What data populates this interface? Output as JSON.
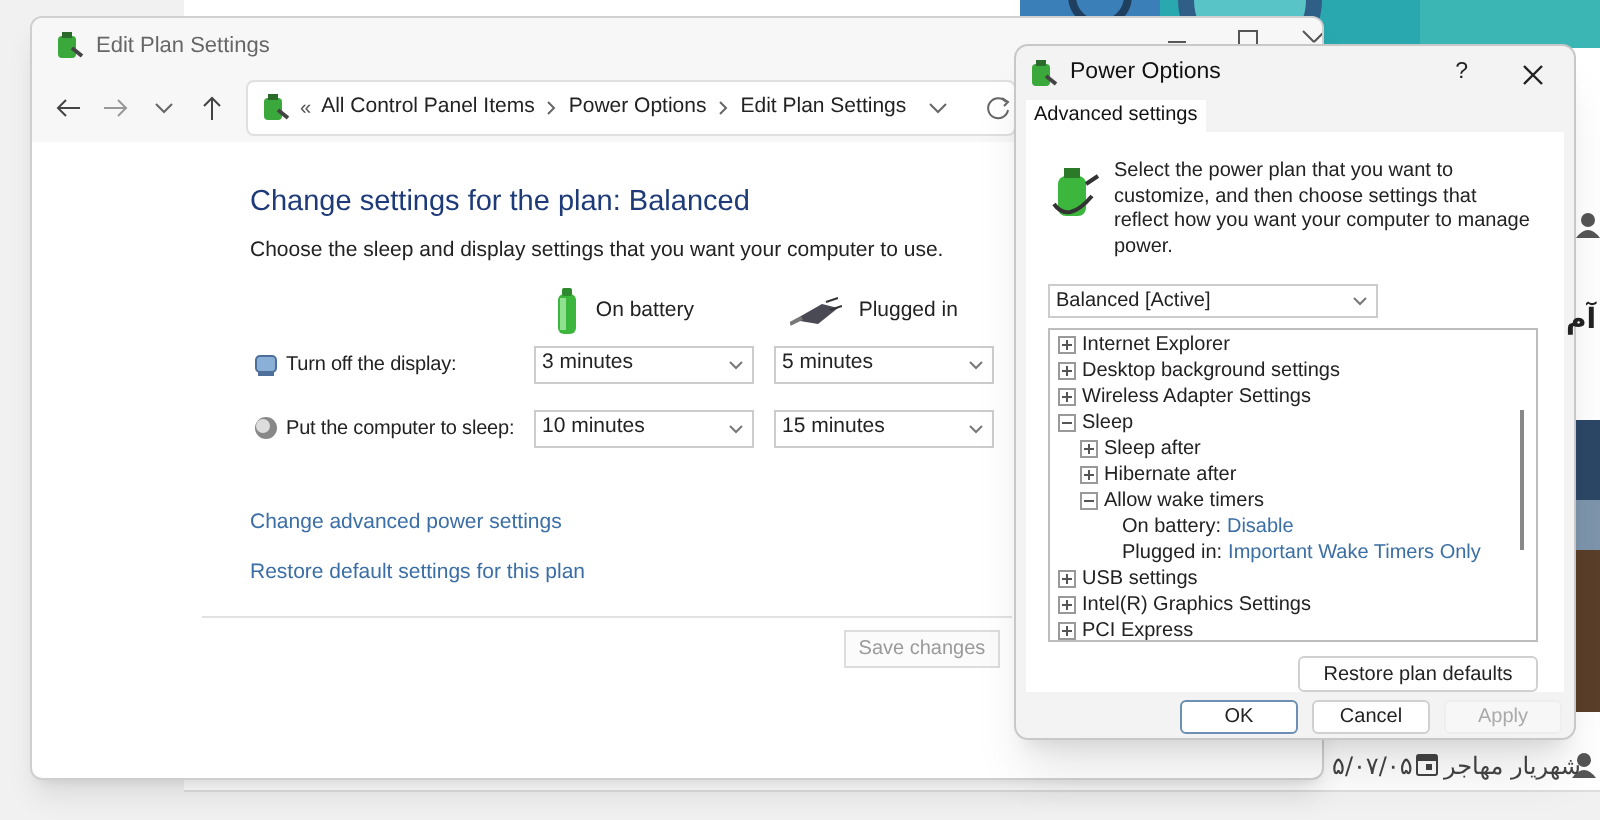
{
  "background_page": {
    "heading_fragment": "آم",
    "author": "شهریار مهاجر",
    "date": "۵/۰۷/۰۵"
  },
  "edit_plan_window": {
    "title": "Edit Plan Settings",
    "breadcrumb_overflow": "«",
    "breadcrumb": [
      "All Control Panel Items",
      "Power Options",
      "Edit Plan Settings"
    ],
    "heading": "Change settings for the plan: Balanced",
    "description": "Choose the sleep and display settings that you want your computer to use.",
    "columns": [
      {
        "kind": "battery",
        "label": "On battery"
      },
      {
        "kind": "plug",
        "label": "Plugged in"
      }
    ],
    "settings": [
      {
        "kind": "display",
        "label": "Turn off the display:",
        "values": [
          "3 minutes",
          "5 minutes"
        ]
      },
      {
        "kind": "sleep",
        "label": "Put the computer to sleep:",
        "values": [
          "10 minutes",
          "15 minutes"
        ]
      }
    ],
    "links": [
      "Change advanced power settings",
      "Restore default settings for this plan"
    ],
    "save_button": {
      "label": "Save changes",
      "disabled": true
    }
  },
  "power_options_dialog": {
    "title": "Power Options",
    "help": "?",
    "tabs": [
      {
        "label": "Advanced settings",
        "selected": true
      }
    ],
    "intro": "Select the power plan that you want to customize, and then choose settings that reflect how you want your computer to manage power.",
    "plan_select": "Balanced [Active]",
    "tree": [
      {
        "label": "Internet Explorer",
        "expanded": false
      },
      {
        "label": "Desktop background settings",
        "expanded": false
      },
      {
        "label": "Wireless Adapter Settings",
        "expanded": false
      },
      {
        "label": "Sleep",
        "expanded": true,
        "children": [
          {
            "label": "Sleep after",
            "expanded": false
          },
          {
            "label": "Hibernate after",
            "expanded": false
          },
          {
            "label": "Allow wake timers",
            "expanded": true,
            "children": [
              {
                "kind": "value",
                "label": "On battery:",
                "value": "Disable"
              },
              {
                "kind": "value",
                "label": "Plugged in:",
                "value": "Important Wake Timers Only"
              }
            ]
          }
        ]
      },
      {
        "label": "USB settings",
        "expanded": false
      },
      {
        "label": "Intel(R) Graphics Settings",
        "expanded": false
      },
      {
        "label": "PCI Express",
        "expanded": false
      }
    ],
    "restore_button": "Restore plan defaults",
    "buttons": [
      {
        "label": "OK",
        "default": true,
        "disabled": false
      },
      {
        "label": "Cancel",
        "default": false,
        "disabled": false
      },
      {
        "label": "Apply",
        "default": false,
        "disabled": true
      }
    ]
  }
}
